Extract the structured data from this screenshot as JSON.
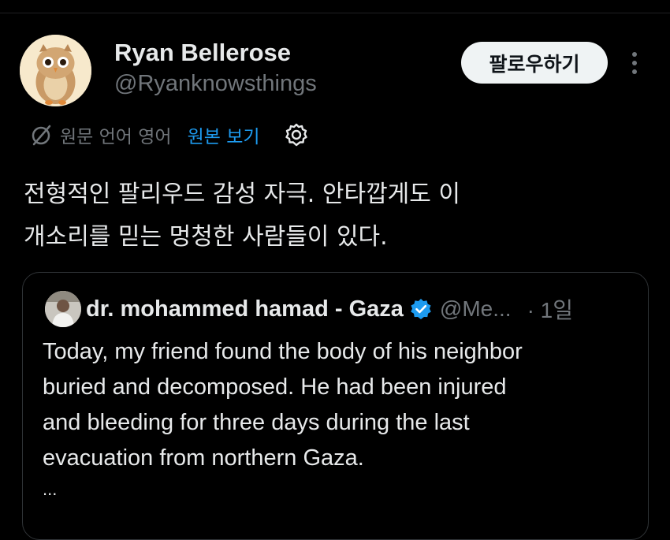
{
  "post": {
    "author": {
      "name": "Ryan Bellerose",
      "handle": "@Ryanknowsthings",
      "avatar": "owl-avatar"
    },
    "follow_label": "팔로우하기",
    "more_icon": "more-vertical-icon",
    "translation": {
      "icon": "translate-icon",
      "info": "원문 언어 영어",
      "show_original": "원본 보기",
      "settings_icon": "gear-icon"
    },
    "text_lines": [
      "전형적인 팔리우드 감성 자극. 안타깝게도 이",
      "개소리를 믿는 멍청한 사람들이 있다."
    ]
  },
  "quote": {
    "author_name": "dr. mohammed hamad - Gaza",
    "verified_icon": "verified-badge-icon",
    "handle": "@Me...",
    "time": "· 1일",
    "text_lines": [
      "Today, my friend found the body of his neighbor",
      "buried and decomposed. He had been injured",
      "and bleeding for three days during the last",
      "evacuation from northern Gaza."
    ],
    "truncation": "..."
  },
  "colors": {
    "background": "#000000",
    "text_primary": "#e7e9ea",
    "text_secondary": "#71767b",
    "link": "#1d9bf0",
    "follow_bg": "#eff3f4",
    "border": "#2f3336"
  }
}
